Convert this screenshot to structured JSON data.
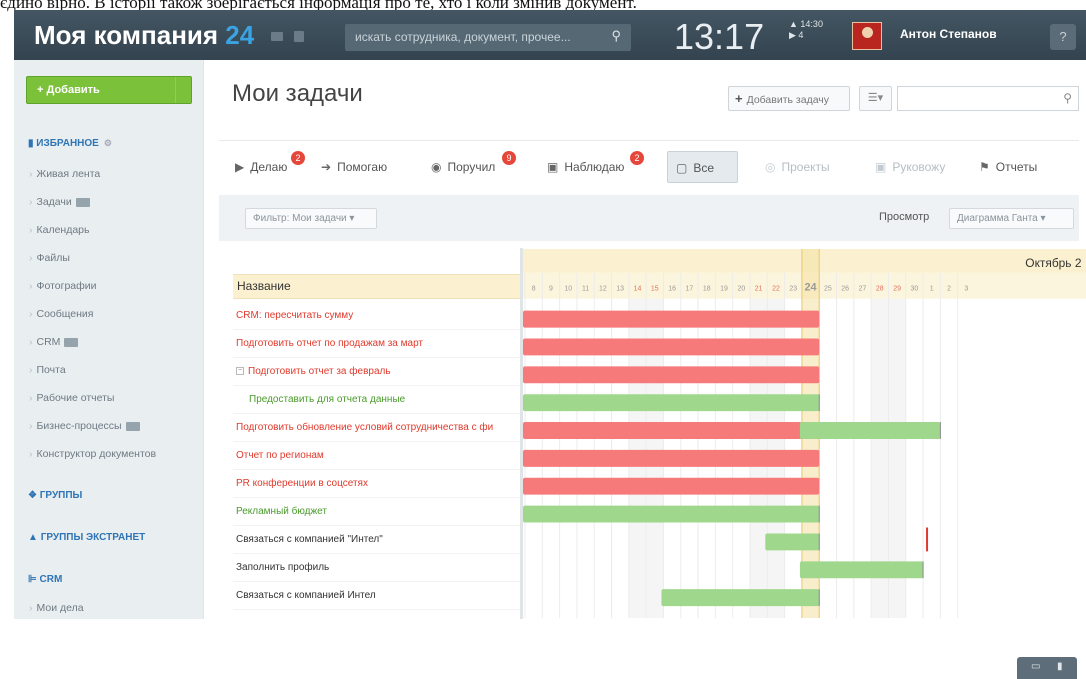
{
  "caption": "єдино вірно. В історії також зберігається інформація про те, хто і коли змінив документ.",
  "header": {
    "brand": "Моя компания",
    "brand_num": "24",
    "search_placeholder": "искать сотрудника, документ, прочее...",
    "clock": "13:17",
    "alarm_time": "14:30",
    "alarm_count": "4",
    "user_name": "Антон Степанов",
    "help": "?"
  },
  "sidebar": {
    "add_button": "+ Добавить",
    "favorites_title": "ИЗБРАННОЕ",
    "items": [
      "Живая лента",
      "Задачи",
      "Календарь",
      "Файлы",
      "Фотографии",
      "Сообщения",
      "CRM",
      "Почта",
      "Рабочие отчеты",
      "Бизнес-процессы",
      "Конструктор документов"
    ],
    "groups_title": "ГРУППЫ",
    "extranet_title": "ГРУППЫ ЭКСТРАНЕТ",
    "crm_title": "CRM",
    "crm_item": "Мои дела"
  },
  "main": {
    "title": "Мои задачи",
    "add_task": "Добавить задачу",
    "tabs": [
      {
        "label": "Делаю",
        "badge": "2",
        "icon": "play-icon"
      },
      {
        "label": "Помогаю",
        "badge": "",
        "icon": "arrow-right-icon"
      },
      {
        "label": "Поручил",
        "badge": "9",
        "icon": "eye-icon"
      },
      {
        "label": "Наблюдаю",
        "badge": "2",
        "icon": "watch-icon"
      },
      {
        "label": "Все",
        "badge": "",
        "icon": "all-icon"
      },
      {
        "label": "Проекты",
        "badge": "",
        "icon": "projects-icon"
      },
      {
        "label": "Руковожу",
        "badge": "",
        "icon": "manage-icon"
      },
      {
        "label": "Отчеты",
        "badge": "",
        "icon": "flag-icon"
      }
    ],
    "filter": "Фильтр: Мои задачи",
    "view_label": "Просмотр",
    "view_value": "Диаграмма Ганта",
    "list_header": "Название",
    "month": "Октябрь 2",
    "days": [
      "8",
      "9",
      "10",
      "11",
      "12",
      "13",
      "14",
      "15",
      "16",
      "17",
      "18",
      "19",
      "20",
      "21",
      "22",
      "23",
      "24",
      "25",
      "26",
      "27",
      "28",
      "29",
      "30",
      "1",
      "2",
      "3"
    ],
    "weekend_days": [
      "14",
      "15",
      "21",
      "22",
      "28",
      "29"
    ],
    "today": "24",
    "tasks": [
      {
        "name": "CRM: пересчитать сумму",
        "color": "red",
        "bars": [
          {
            "start": "8",
            "end": "24",
            "status": "overdue"
          }
        ],
        "deadline": ""
      },
      {
        "name": "Подготовить отчет по продажам за март",
        "color": "red",
        "bars": [
          {
            "start": "8",
            "end": "24",
            "status": "overdue"
          }
        ],
        "deadline": ""
      },
      {
        "name": "Подготовить отчет за февраль",
        "color": "red",
        "expand": true,
        "bars": [
          {
            "start": "8",
            "end": "24",
            "status": "overdue"
          }
        ],
        "deadline": ""
      },
      {
        "name": "Предоставить для отчета данные",
        "color": "green",
        "indent": true,
        "bars": [
          {
            "start": "8",
            "end": "24",
            "status": "ok"
          }
        ],
        "deadline": ""
      },
      {
        "name": "Подготовить обновление условий сотрудничества с фи",
        "color": "red",
        "bars": [
          {
            "start": "8",
            "end": "24",
            "status": "overdue"
          },
          {
            "start": "24",
            "end": "1",
            "status": "ok"
          }
        ],
        "deadline": ""
      },
      {
        "name": "Отчет по регионам",
        "color": "red",
        "bars": [
          {
            "start": "8",
            "end": "24",
            "status": "overdue"
          }
        ],
        "deadline": ""
      },
      {
        "name": "PR конференции в соцсетях",
        "color": "red",
        "bars": [
          {
            "start": "8",
            "end": "24",
            "status": "overdue"
          }
        ],
        "deadline": ""
      },
      {
        "name": "Рекламный бюджет",
        "color": "green",
        "bars": [
          {
            "start": "8",
            "end": "24",
            "status": "ok"
          }
        ],
        "deadline": ""
      },
      {
        "name": "Связаться с компанией \"Интел\"",
        "color": "dark",
        "bars": [
          {
            "start": "22",
            "end": "24",
            "status": "ok"
          }
        ],
        "deadline": "30"
      },
      {
        "name": "Заполнить профиль",
        "color": "dark",
        "bars": [
          {
            "start": "24",
            "end": "30",
            "status": "ok"
          }
        ],
        "deadline": ""
      },
      {
        "name": "Связаться с компанией Интел",
        "color": "dark",
        "bars": [
          {
            "start": "16",
            "end": "24",
            "status": "ok"
          }
        ],
        "deadline": ""
      }
    ]
  },
  "colors": {
    "overdue": "#f77a7a",
    "ok": "#9fd88d",
    "today": "#f5e3a8",
    "header_bg": "#3c4d5a"
  }
}
